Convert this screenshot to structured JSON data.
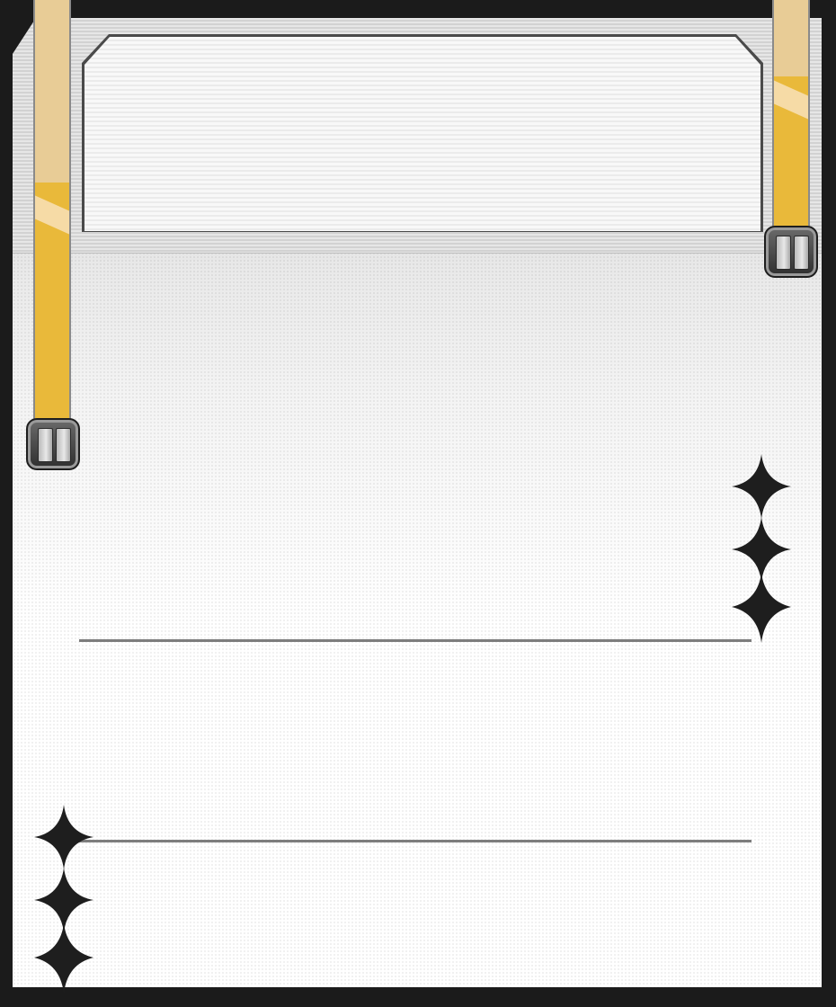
{
  "card": {
    "title": "",
    "description": "",
    "flavor_text": ""
  },
  "colors": {
    "frame": "#1b1b1b",
    "strap_light": "#e8cc96",
    "strap_gold": "#e9b93a",
    "divider": "#7d7d7d",
    "sparkle": "#1e1e1e"
  },
  "icons": {
    "strap_left": "gold-strap-icon",
    "strap_right": "gold-strap-icon",
    "buckle_left": "buckle-icon",
    "buckle_right": "buckle-icon",
    "sparkle_top_right": "four-point-star-icon",
    "sparkle_bottom_left": "four-point-star-icon"
  }
}
